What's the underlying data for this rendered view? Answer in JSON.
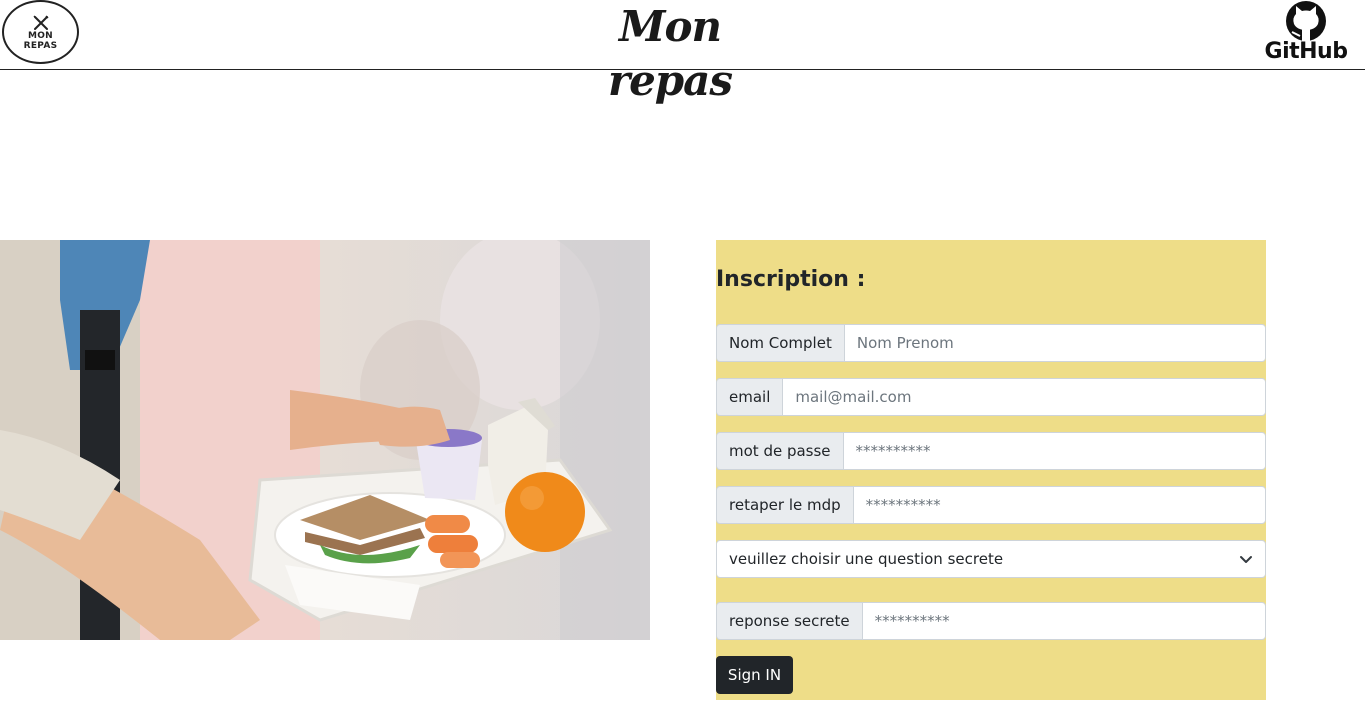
{
  "header": {
    "logo": {
      "line1": "MON",
      "line2": "REPAS",
      "icon": "cutlery-icon"
    },
    "title": "Mon repas",
    "github": {
      "label": "GitHub",
      "icon": "github-icon"
    }
  },
  "hero_image": {
    "description_icon": "school-lunch-tray-photo"
  },
  "form": {
    "heading": "Inscription :",
    "fields": [
      {
        "label": "Nom Complet",
        "placeholder": "Nom Prenom",
        "value": ""
      },
      {
        "label": "email",
        "placeholder": "mail@mail.com",
        "value": ""
      },
      {
        "label": "mot de passe",
        "placeholder": "**********",
        "value": ""
      },
      {
        "label": "retaper le mdp",
        "placeholder": "**********",
        "value": ""
      }
    ],
    "secret_question": {
      "selected": "veuillez choisir une question secrete",
      "icon": "chevron-down-icon"
    },
    "secret_answer": {
      "label": "reponse secrete",
      "placeholder": "**********",
      "value": ""
    },
    "submit_label": "Sign IN"
  },
  "colors": {
    "panel_background": "#eedd88",
    "button_background": "#212529",
    "addon_background": "#e9ecef"
  }
}
